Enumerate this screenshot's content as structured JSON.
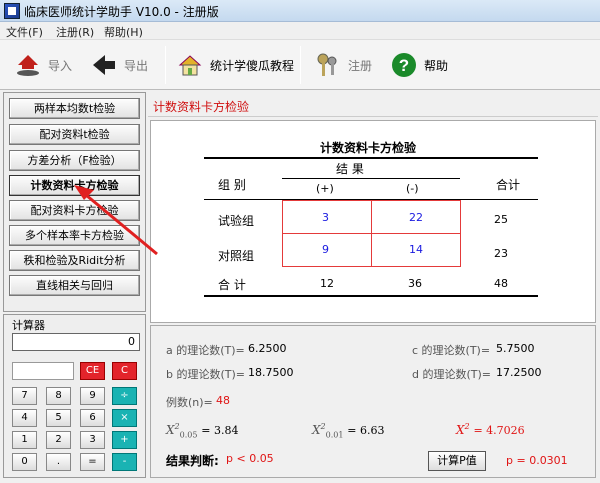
{
  "window": {
    "title": "临床医师统计学助手 V10.0 - 注册版"
  },
  "menu": [
    "文件(F)",
    "注册(R)",
    "帮助(H)"
  ],
  "toolbar": {
    "import_label": "导入",
    "export_label": "导出",
    "tutorial_label": "统计学傻瓜教程",
    "register_label": "注册",
    "help_label": "帮助"
  },
  "sidebar": {
    "buttons": [
      "两样本均数t检验",
      "配对资料t检验",
      "方差分析（F检验）",
      "计数资料卡方检验",
      "配对资料卡方检验",
      "多个样本率卡方检验",
      "秩和检验及Ridit分析",
      "直线相关与回归"
    ],
    "active_index": 3
  },
  "calculator": {
    "title": "计算器",
    "display": "0",
    "keys": {
      "ce": "CE",
      "c": "C",
      "row1": [
        "7",
        "8",
        "9",
        "÷"
      ],
      "row2": [
        "4",
        "5",
        "6",
        "×"
      ],
      "row3": [
        "1",
        "2",
        "3",
        "+"
      ],
      "row4": [
        "0",
        ".",
        "=",
        "-"
      ]
    }
  },
  "section_title": "计数资料卡方检验",
  "table": {
    "title": "计数资料卡方检验",
    "col_group": "组  别",
    "result_header": "结    果",
    "pos_header": "(+)",
    "neg_header": "(-)",
    "total_header": "合计",
    "rows": [
      {
        "label": "试验组",
        "pos": "3",
        "neg": "22",
        "total": "25"
      },
      {
        "label": "对照组",
        "pos": "9",
        "neg": "14",
        "total": "23"
      },
      {
        "label": "合  计",
        "pos": "12",
        "neg": "36",
        "total": "48"
      }
    ]
  },
  "results": {
    "a_label": "a 的理论数(T)=",
    "a_val": "6.2500",
    "b_label": "b 的理论数(T)=",
    "b_val": "18.7500",
    "c_label": "c 的理论数(T)=",
    "c_val": "5.7500",
    "d_label": "d 的理论数(T)=",
    "d_val": "17.2500",
    "n_label": "例数(n)=",
    "n_val": "48",
    "chi05_label": "X",
    "chi05_sup": "2",
    "chi05_sub": "0.05",
    "chi05_val": "= 3.84",
    "chi01_label": "X",
    "chi01_sup": "2",
    "chi01_sub": "0.01",
    "chi01_val": "= 6.63",
    "chi_label": "X",
    "chi_sup": "2",
    "chi_val": "= 4.7026",
    "conclusion_label": "结果判断:",
    "conclusion_val": "p < 0.05",
    "calc_button": "计算P值",
    "p_val": "p = 0.0301"
  }
}
